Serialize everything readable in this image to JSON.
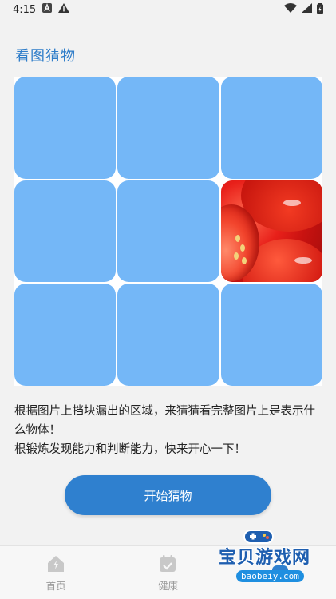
{
  "status_bar": {
    "time": "4:15"
  },
  "page": {
    "title": "看图猜物"
  },
  "grid": {
    "rows": 3,
    "cols": 3,
    "revealed_cell": "row 2, col 3",
    "cover_color": "#74b7f7"
  },
  "description": {
    "line1": "根据图片上挡块漏出的区域，来猜猜看完整图片上是表示什么物体！",
    "line2": "根锻炼发现能力和判断能力，快来开心一下！"
  },
  "start_button": {
    "label": "开始猜物"
  },
  "bottom_nav": {
    "items": [
      {
        "label": "首页",
        "icon": "home-icon"
      },
      {
        "label": "健康",
        "icon": "calendar-check-icon"
      },
      {
        "label": "",
        "icon": "game-icon"
      }
    ]
  },
  "watermark": {
    "text": "宝贝游戏网",
    "url": "baobeiy.com"
  },
  "colors": {
    "accent": "#2f80cf",
    "title": "#2f7dc9",
    "background": "#f2f2f2"
  }
}
